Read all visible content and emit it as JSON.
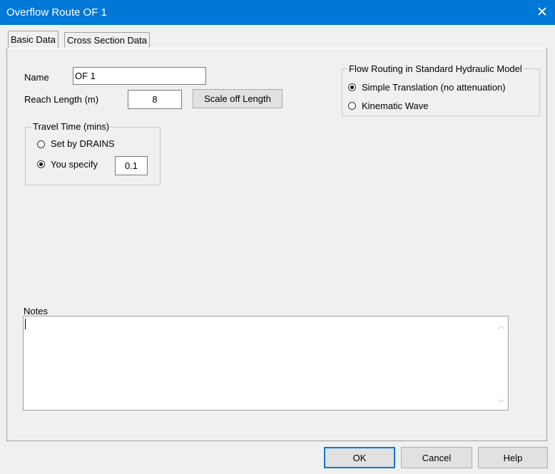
{
  "window": {
    "title": "Overflow Route OF 1",
    "close_glyph": "✕"
  },
  "tabs": [
    {
      "label": "Basic Data"
    },
    {
      "label": "Cross Section Data"
    }
  ],
  "basic": {
    "name_label": "Name",
    "name_value": "OF 1",
    "reach_label": "Reach Length (m)",
    "reach_value": "8",
    "scale_button": "Scale off Length"
  },
  "travel_time": {
    "legend": "Travel Time (mins)",
    "option_drains": "Set by DRAINS",
    "option_specify": "You specify",
    "specify_value": "0.1",
    "selected": "You specify"
  },
  "flow_routing": {
    "legend": "Flow Routing in Standard Hydraulic Model",
    "option_simple": "Simple Translation (no attenuation)",
    "option_kinematic": "Kinematic Wave",
    "selected": "Simple Translation (no attenuation)"
  },
  "notes": {
    "label": "Notes",
    "value": ""
  },
  "buttons": {
    "ok": "OK",
    "cancel": "Cancel",
    "help": "Help"
  },
  "colors": {
    "titlebar": "#0078d7",
    "background": "#f0f0f0"
  }
}
